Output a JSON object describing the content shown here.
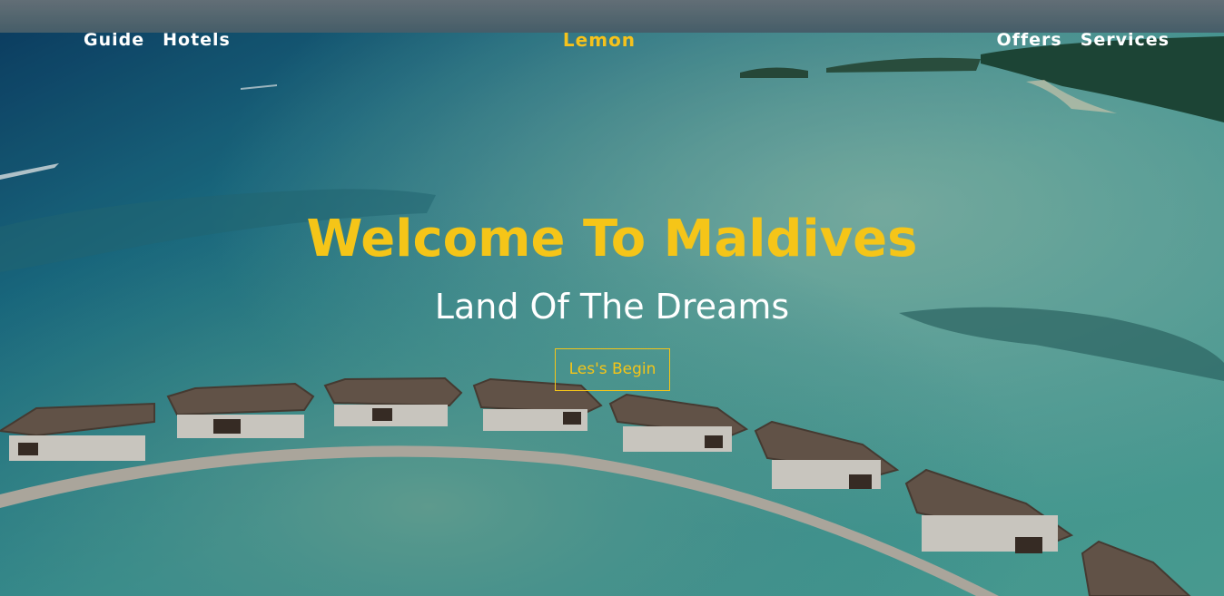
{
  "nav": {
    "left_links": [
      "Guide",
      "Hotels"
    ],
    "brand": "Lemon",
    "right_links": [
      "Offers",
      "Services"
    ]
  },
  "hero": {
    "title": "Welcome To Maldives",
    "subtitle": "Land Of The Dreams",
    "cta_label": "Les's Begin",
    "background": "aerial-maldives-water-villas-photo"
  },
  "colors": {
    "accent": "#f5c518",
    "nav_text": "#ffffff",
    "deep_water": "#0f4f73",
    "lagoon": "#3f9c9a"
  }
}
